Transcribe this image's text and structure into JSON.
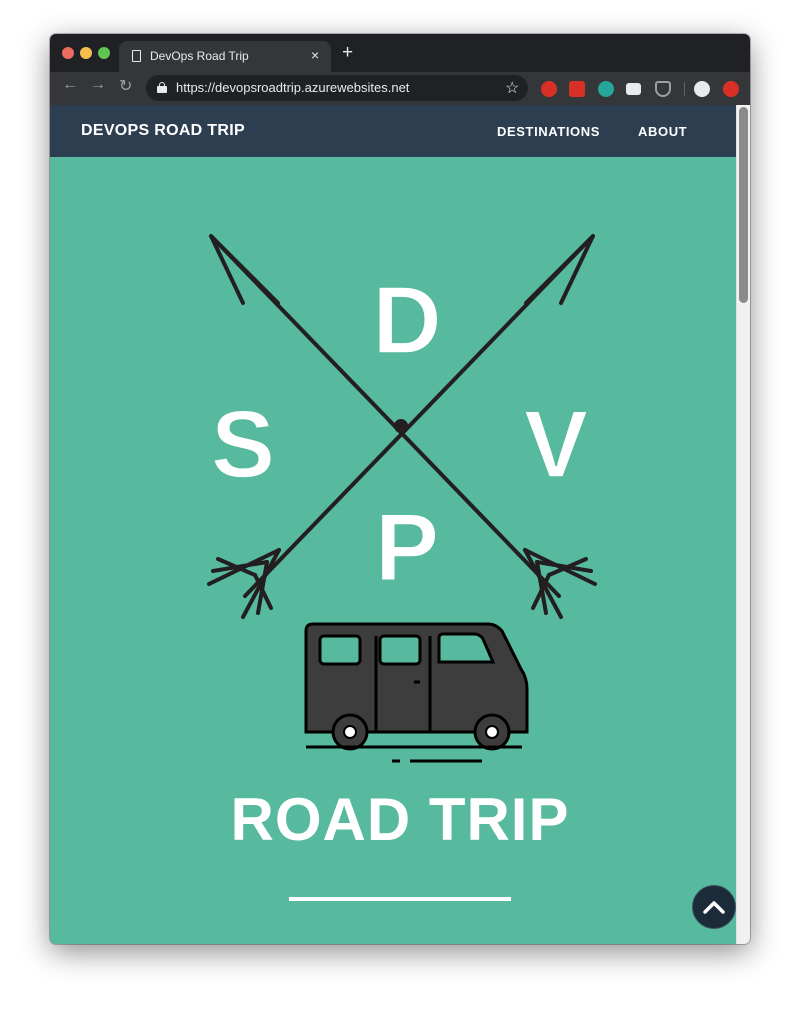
{
  "browser": {
    "tab_title": "DevOps Road Trip",
    "tab_close": "×",
    "new_tab": "+",
    "url": "https://devopsroadtrip.azurewebsites.net",
    "back_icon": "←",
    "forward_icon": "→",
    "reload_icon": "↻",
    "bookmark_icon": "☆",
    "extensions": [
      {
        "name": "hand-stop-extension",
        "color": "#d93025"
      },
      {
        "name": "dots-extension",
        "color": "#d93025"
      },
      {
        "name": "circle-extension",
        "color": "#26a69a"
      },
      {
        "name": "chat-extension",
        "color": "#e8eaed"
      },
      {
        "name": "pocket-extension",
        "color": "#9aa0a6"
      },
      {
        "name": "avatar",
        "color": "#e8eaed"
      },
      {
        "name": "update-extension",
        "color": "#d93025"
      }
    ]
  },
  "site": {
    "brand": "DEVOPS ROAD TRIP",
    "nav": [
      "DESTINATIONS",
      "ABOUT"
    ],
    "logo_letters": {
      "top": "D",
      "left": "S",
      "right": "V",
      "bottom": "P"
    },
    "hero_title": "ROAD TRIP",
    "colors": {
      "hero": "#57b99d",
      "header": "#2c3e50",
      "ink": "#231f20",
      "van": "#3d3d3d"
    }
  }
}
